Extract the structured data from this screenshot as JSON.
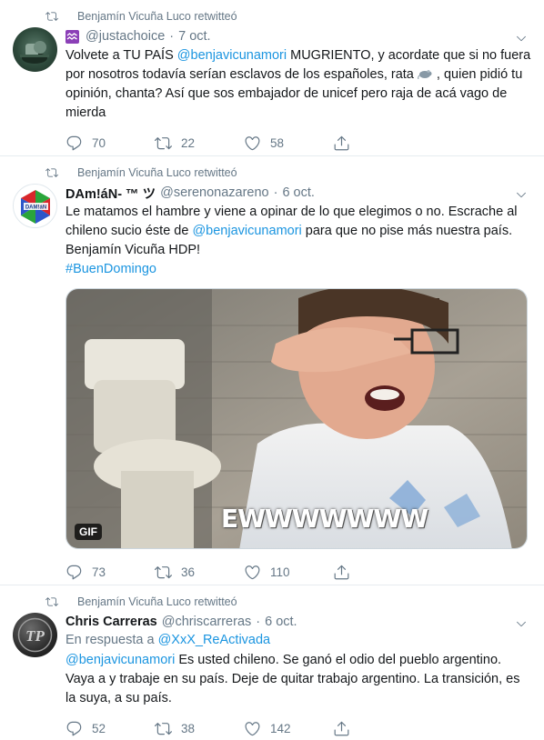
{
  "retweet_label": "Benjamín Vicuña Luco retwitteó",
  "tweets": [
    {
      "display_name": "",
      "handle": "@justachoice",
      "time": "7 oct.",
      "text_parts": [
        "Volvete a TU PAÍS ",
        "@benjavicunamori",
        " MUGRIENTO, y acordate que si no fuera por nosotros todavía serían esclavos de los españoles, rata ",
        " , quien pidió tu opinión, chanta? Así que sos embajador de unicef pero raja de acá vago de mierda"
      ],
      "replies": "70",
      "retweets": "22",
      "likes": "58"
    },
    {
      "display_name": "DAm!áN- ™ ツ",
      "handle": "@serenonazareno",
      "time": "6 oct.",
      "text_parts": [
        "Le matamos el hambre y viene a opinar de lo que elegimos o no. Escrache al chileno sucio éste de ",
        "@benjavicunamori",
        " para que no pise más nuestra país. Benjamín Vicuña HDP!",
        "#BuenDomingo"
      ],
      "gif_badge": "GIF",
      "gif_caption": "EWWWWWWW",
      "replies": "73",
      "retweets": "36",
      "likes": "110"
    },
    {
      "display_name": "Chris Carreras",
      "handle": "@chriscarreras",
      "time": "6 oct.",
      "reply_prefix": "En respuesta a ",
      "reply_handle": "@XxX_ReActivada",
      "text_parts": [
        "@benjavicunamori",
        " Es usted chileno. Se ganó el odio del pueblo argentino. Vaya a y trabaje en su país. Deje de quitar trabajo argentino. La transición, es la suya, a su país."
      ],
      "replies": "52",
      "retweets": "38",
      "likes": "142"
    }
  ],
  "colors": {
    "link": "#1b95e0",
    "muted": "#657786",
    "text": "#14171a",
    "divider": "#e6ecf0"
  }
}
